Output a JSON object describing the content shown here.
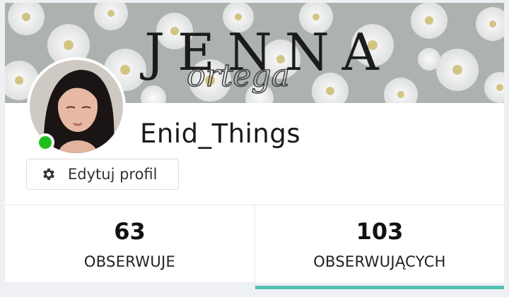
{
  "profile": {
    "banner": {
      "title": "JENNA",
      "subtitle": "ortega"
    },
    "username": "Enid_Things",
    "status_color": "#1fbf1f",
    "edit_button": {
      "icon": "gear-icon",
      "label": "Edytuj profil"
    }
  },
  "stats": [
    {
      "value": "63",
      "label": "OBSERWUJE",
      "active": false
    },
    {
      "value": "103",
      "label": "OBSERWUJĄCYCH",
      "active": true
    }
  ],
  "colors": {
    "accent": "#4fc2b0",
    "online": "#1fbf1f"
  }
}
